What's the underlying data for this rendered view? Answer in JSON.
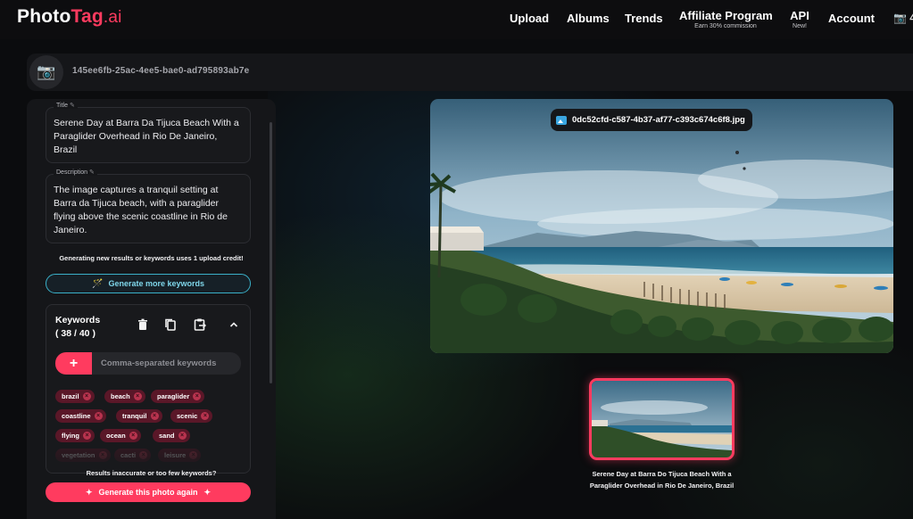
{
  "app": {
    "logo_part1": "Photo",
    "logo_part2": "Tag",
    "logo_part3": ".ai",
    "brand_color": "#ff3b5f"
  },
  "nav": {
    "upload": "Upload",
    "albums": "Albums",
    "trends": "Trends",
    "affiliate": "Affiliate Program",
    "affiliate_sub": "Earn 30% commission",
    "api": "API",
    "api_sub": "New!",
    "account": "Account",
    "credits_icon": "camera-icon",
    "credits_value": "4"
  },
  "album": {
    "id": "145ee6fb-25ac-4ee5-bae0-ad795893ab7e",
    "icon": "camera-icon"
  },
  "editor": {
    "title_label": "Title",
    "title_value": "Serene Day at Barra Da Tijuca Beach With a Paraglider Overhead in Rio De Janeiro, Brazil",
    "description_label": "Description",
    "description_value": "The image captures a tranquil setting at Barra da Tijuca beach, with a paraglider flying above the scenic coastline in Rio de Janeiro.",
    "credit_note": "Generating new results or keywords uses 1 upload credit!",
    "generate_more_label": "Generate more keywords",
    "keywords_label": "Keywords",
    "keywords_count": "( 38 / 40 )",
    "keyword_placeholder": "Comma-separated keywords",
    "keywords": [
      "brazil",
      "beach",
      "paraglider",
      "coastline",
      "tranquil",
      "scenic",
      "flying",
      "ocean",
      "sand",
      "vegetation",
      "cacti",
      "leisure"
    ],
    "inaccurate_note": "Results inaccurate or too few keywords?",
    "regenerate_label": "Generate this photo again"
  },
  "photo": {
    "filename": "0dc52cfd-c587-4b37-af77-c393c674c6f8.jpg",
    "caption": "Serene Day at Barra Do Tijuca Beach With a Paraglider Overhead in Rio De Janeiro, Brazil"
  }
}
